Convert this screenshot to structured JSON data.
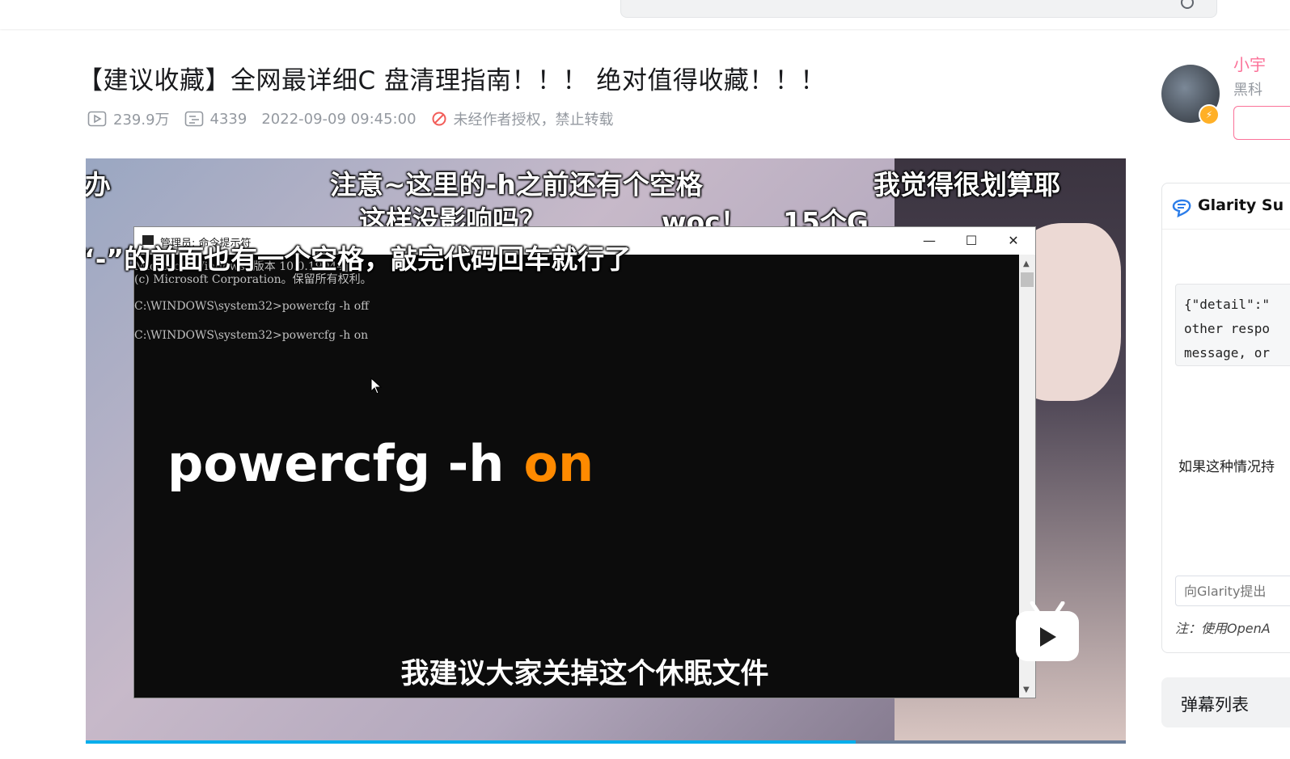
{
  "header": {
    "search_placeholder": ""
  },
  "video": {
    "title": "【建议收藏】全网最详细C 盘清理指南！！！ 绝对值得收藏！！！",
    "views": "239.9万",
    "danmaku_count": "4339",
    "publish_time": "2022-09-09 09:45:00",
    "copyright_notice": "未经作者授权，禁止转载",
    "progress_fraction": 0.74
  },
  "player": {
    "danmaku": [
      "办",
      "注意~这里的-h之前还有个空格",
      "我觉得很划算耶",
      "这样没影响吗？",
      "woc！",
      "15个G",
      "“-”的前面也有一个空格，敲完代码回车就行了"
    ],
    "cmd_window": {
      "title": "管理员: 命令提示符",
      "lines": [
        "Microsoft Windows [版本 10.0.19044]",
        "(c) Microsoft Corporation。保留所有权利。",
        "C:\\WINDOWS\\system32>powercfg -h off",
        "C:\\WINDOWS\\system32>powercfg -h on"
      ],
      "minimize": "—",
      "maximize": "☐",
      "close": "✕"
    },
    "overlay_command": "powercfg -h",
    "overlay_highlight": "on",
    "subtitle": "我建议大家关掉这个休眠文件"
  },
  "uploader": {
    "name": "小宇",
    "desc": "黑科"
  },
  "glarity": {
    "title": "Glarity Su",
    "code_lines": [
      "{\"detail\":\"",
      "other respo",
      "message, or"
    ],
    "answer": "如果这种情况持",
    "input_placeholder": "向Glarity提出",
    "note": "注：使用OpenA"
  },
  "danmu_list": {
    "label": "弹幕列表"
  },
  "colors": {
    "accent_blue": "#00aeec",
    "pink": "#fb7299",
    "highlight_orange": "#ff8a00"
  }
}
